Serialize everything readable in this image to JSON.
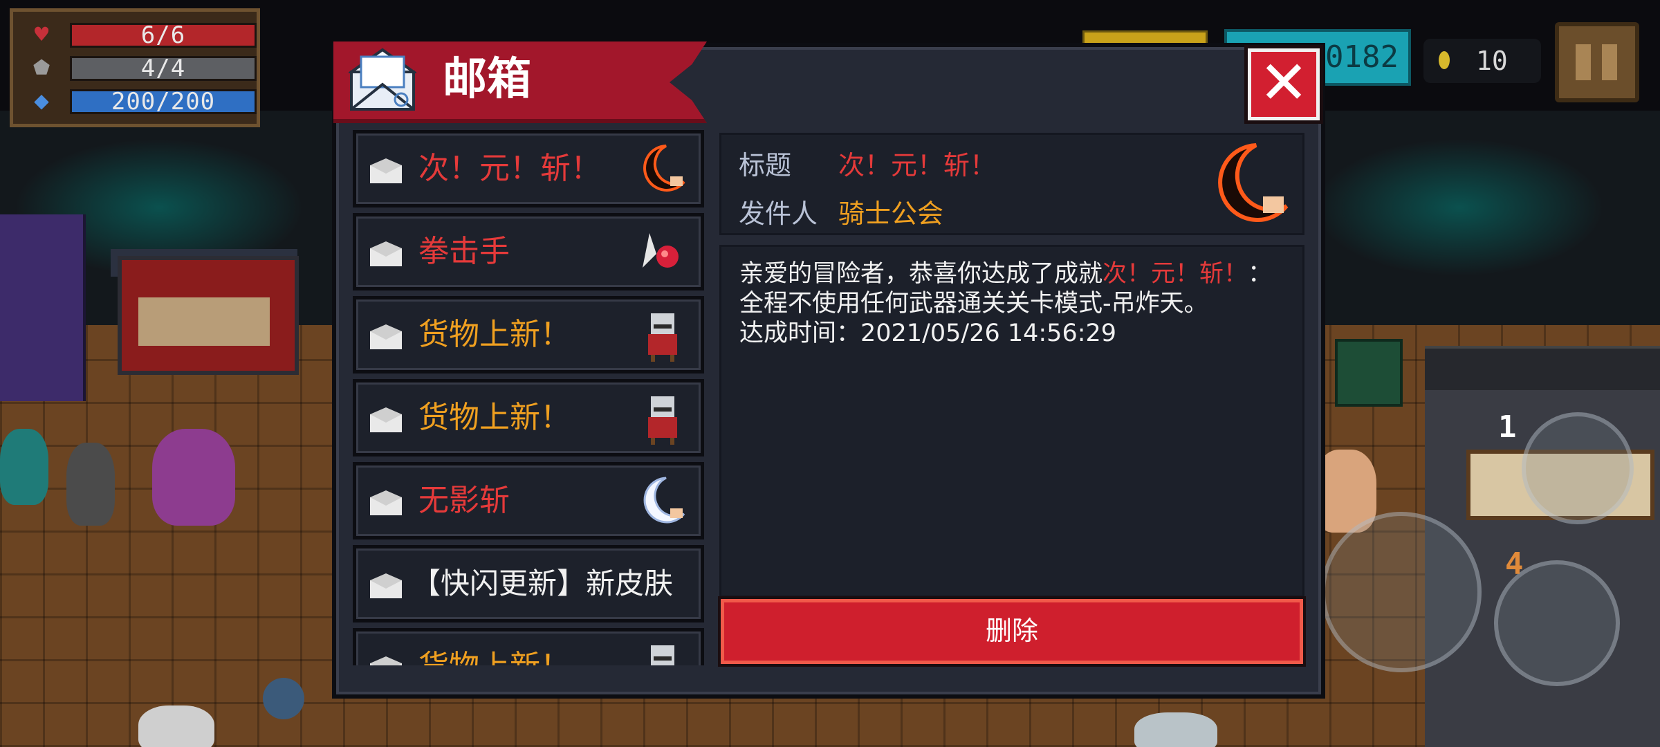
{
  "hud": {
    "health": {
      "text": "6/6",
      "current": 6,
      "max": 6,
      "color": "#b3262a"
    },
    "armor": {
      "text": "4/4",
      "current": 4,
      "max": 4,
      "color": "#5d5f63"
    },
    "energy": {
      "text": "200/200",
      "current": 200,
      "max": 200,
      "color": "#2f6fc3"
    },
    "gems_text": "0182",
    "coins_text": "10",
    "skill_1_count": "1",
    "skill_2_count": "4",
    "icons": [
      "heart-icon",
      "shield-icon",
      "energy-crystal-icon",
      "coin-icon",
      "pause-icon",
      "gem-icon"
    ]
  },
  "mailbox": {
    "title": "邮箱",
    "close_label": "✕",
    "items": [
      {
        "subject": "次！元！斩！",
        "color": "#e53a3a",
        "thumb": "crescent-blade-red-icon"
      },
      {
        "subject": "拳击手",
        "color": "#e53a3a",
        "thumb": "boxer-glove-icon"
      },
      {
        "subject": "货物上新！",
        "color": "#f0a020",
        "thumb": "merchant-cat-icon"
      },
      {
        "subject": "货物上新！",
        "color": "#f0a020",
        "thumb": "merchant-cat-icon"
      },
      {
        "subject": "无影斩",
        "color": "#e53a3a",
        "thumb": "crescent-blade-white-icon"
      },
      {
        "subject": "【快闪更新】新皮肤",
        "color": "#f1f1f1",
        "thumb": ""
      },
      {
        "subject": "货物上新！",
        "color": "#f0a020",
        "thumb": "merchant-cat-icon"
      }
    ],
    "detail": {
      "title_label": "标题",
      "title_value": "次！元！斩！",
      "sender_label": "发件人",
      "sender_value": "骑士公会",
      "body_prefix": "亲爱的冒险者，恭喜你达成了成就",
      "body_highlight": "次！元！斩！",
      "body_suffix": "：全程不使用任何武器通关关卡模式-吊炸天。",
      "achieved_time": "达成时间：2021/05/26 14:56:29"
    },
    "delete_label": "删除"
  }
}
